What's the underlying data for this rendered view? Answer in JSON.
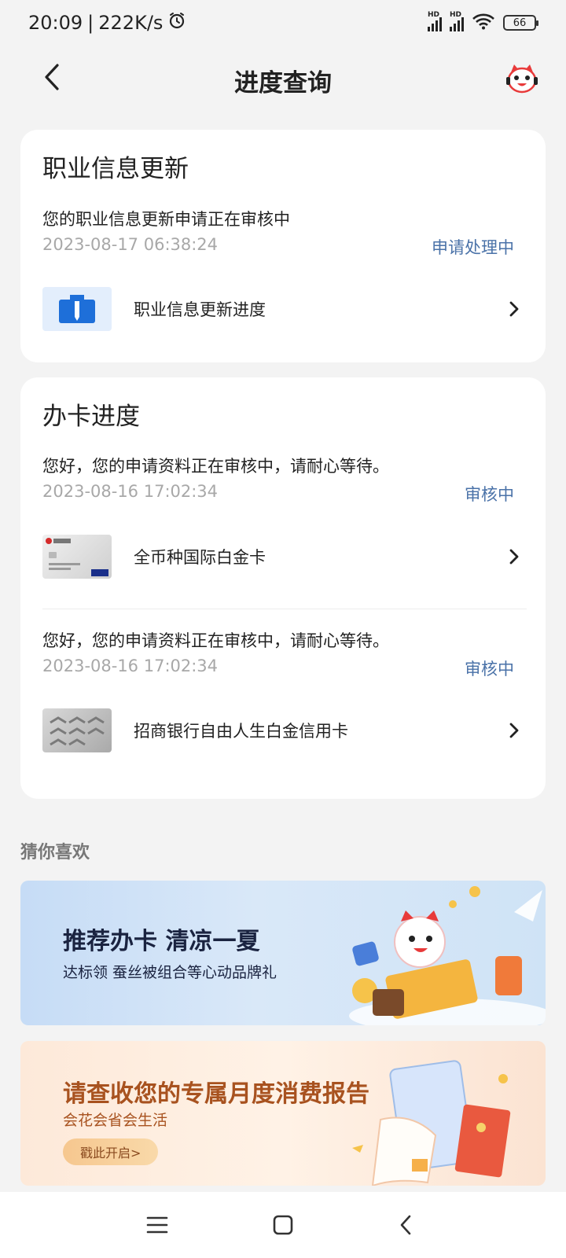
{
  "status_bar": {
    "time": "20:09",
    "speed": "222K/s",
    "battery": "66",
    "signal_label": "HD"
  },
  "header": {
    "title": "进度查询"
  },
  "occupation": {
    "title": "职业信息更新",
    "message": "您的职业信息更新申请正在审核中",
    "timestamp": "2023-08-17 06:38:24",
    "status": "申请处理中",
    "item_label": "职业信息更新进度"
  },
  "card_progress": {
    "title": "办卡进度",
    "applications": [
      {
        "message": "您好，您的申请资料正在审核中，请耐心等待。",
        "timestamp": "2023-08-16 17:02:34",
        "status": "审核中",
        "card_name": "全币种国际白金卡"
      },
      {
        "message": "您好，您的申请资料正在审核中，请耐心等待。",
        "timestamp": "2023-08-16 17:02:34",
        "status": "审核中",
        "card_name": "招商银行自由人生白金信用卡"
      }
    ]
  },
  "recommend": {
    "title": "猜你喜欢",
    "banners": [
      {
        "title": "推荐办卡 清凉一夏",
        "subtitle": "达标领 蚕丝被组合等心动品牌礼"
      },
      {
        "title": "请查收您的专属月度消费报告",
        "subtitle": "会花会省会生活",
        "button": "戳此开启>"
      }
    ]
  },
  "colors": {
    "accent_blue": "#4a72a8",
    "card_bg": "#ffffff",
    "page_bg": "#f3f3f3"
  }
}
